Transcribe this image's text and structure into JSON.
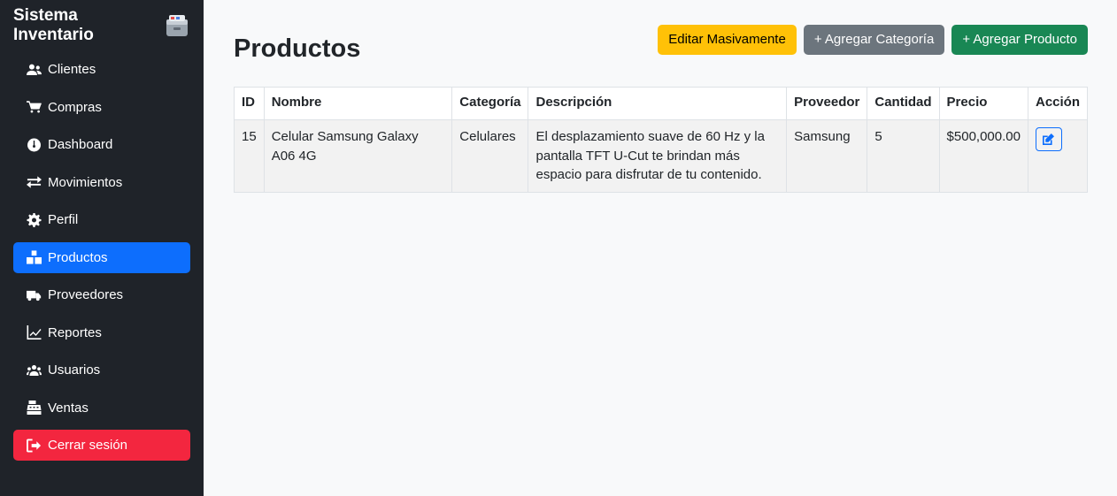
{
  "sidebar": {
    "brand": "Sistema Inventario",
    "brand_icon": "archive-box-icon",
    "items": [
      {
        "label": "Clientes",
        "icon": "users-icon"
      },
      {
        "label": "Compras",
        "icon": "cart-icon"
      },
      {
        "label": "Dashboard",
        "icon": "gauge-icon"
      },
      {
        "label": "Movimientos",
        "icon": "exchange-icon"
      },
      {
        "label": "Perfil",
        "icon": "gear-icon"
      },
      {
        "label": "Productos",
        "icon": "boxes-icon"
      },
      {
        "label": "Proveedores",
        "icon": "truck-icon"
      },
      {
        "label": "Reportes",
        "icon": "chart-line-icon"
      },
      {
        "label": "Usuarios",
        "icon": "users-group-icon"
      },
      {
        "label": "Ventas",
        "icon": "cash-register-icon"
      }
    ],
    "logout": {
      "label": "Cerrar sesión",
      "icon": "sign-out-icon"
    },
    "active": "Productos"
  },
  "header": {
    "title": "Productos",
    "buttons": {
      "bulk_edit": "Editar Masivamente",
      "add_category": "+ Agregar Categoría",
      "add_product": "+ Agregar Producto"
    }
  },
  "table": {
    "columns": [
      "ID",
      "Nombre",
      "Categoría",
      "Descripción",
      "Proveedor",
      "Cantidad",
      "Precio",
      "Acción"
    ],
    "rows": [
      {
        "id": "15",
        "nombre": "Celular Samsung Galaxy A06 4G",
        "categoria": "Celulares",
        "descripcion": "El desplazamiento suave de 60 Hz y la pantalla TFT U-Cut te brindan más espacio para disfrutar de tu contenido.",
        "proveedor": "Samsung",
        "cantidad": "5",
        "precio": "$500,000.00",
        "action_icon": "edit-icon"
      }
    ]
  },
  "colors": {
    "sidebar_bg": "#1f2329",
    "active": "#0d6efd",
    "logout": "#f3263f",
    "warning": "#ffc107",
    "secondary": "#6c757d",
    "success": "#198754"
  }
}
